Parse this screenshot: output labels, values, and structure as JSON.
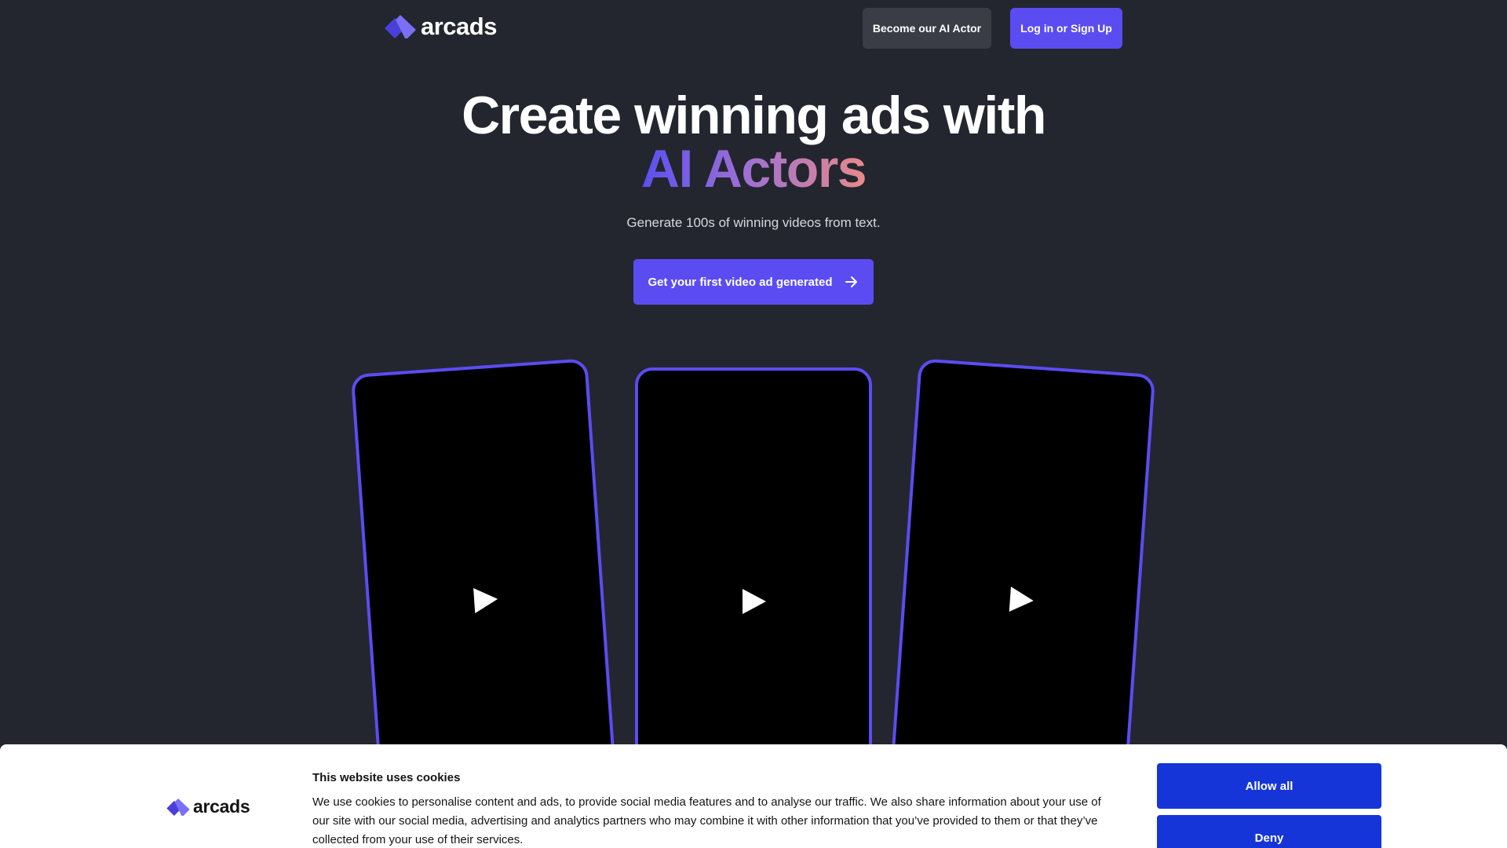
{
  "header": {
    "logo_text": "arcads",
    "become_actor_label": "Become our AI Actor",
    "login_label": "Log in or Sign Up"
  },
  "hero": {
    "title_line1": "Create winning ads with",
    "title_line2": "AI Actors",
    "subtitle": "Generate 100s of winning videos from text.",
    "cta_label": "Get your first video ad generated",
    "cta_icon": "arrow-right-icon"
  },
  "videos": [
    {
      "icon": "play-icon"
    },
    {
      "icon": "play-icon"
    },
    {
      "icon": "play-icon"
    }
  ],
  "cookie_banner": {
    "logo_text": "arcads",
    "title": "This website uses cookies",
    "body": "We use cookies to personalise content and ads, to provide social media features and to analyse our traffic. We also share information about your use of our site with our social media, advertising and analytics partners who may combine it with other information that you’ve provided to them or that they’ve collected from your use of their services.",
    "allow_label": "Allow all",
    "deny_label": "Deny"
  },
  "colors": {
    "background": "#23262e",
    "accent": "#5b4cf2",
    "cookie_button": "#1535d9",
    "gradient_start": "#5a4ff0",
    "gradient_end": "#e88a8a"
  }
}
